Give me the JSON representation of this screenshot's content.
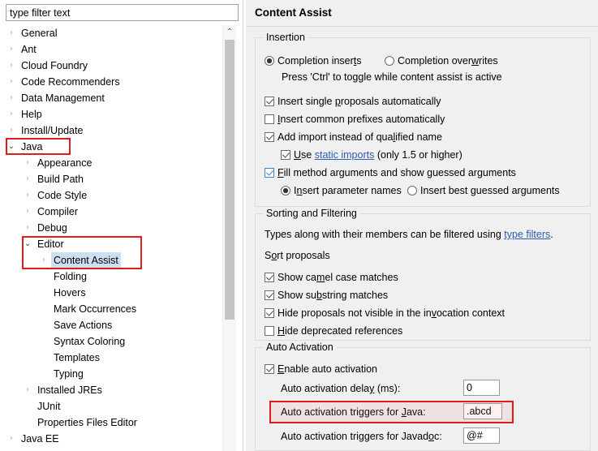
{
  "filter": {
    "placeholder": "type filter text",
    "value": ""
  },
  "tree": {
    "items": [
      {
        "label": "General",
        "indent": 0,
        "arrow": "collapsed",
        "selected": false
      },
      {
        "label": "Ant",
        "indent": 0,
        "arrow": "collapsed",
        "selected": false
      },
      {
        "label": "Cloud Foundry",
        "indent": 0,
        "arrow": "collapsed",
        "selected": false
      },
      {
        "label": "Code Recommenders",
        "indent": 0,
        "arrow": "collapsed",
        "selected": false
      },
      {
        "label": "Data Management",
        "indent": 0,
        "arrow": "collapsed",
        "selected": false
      },
      {
        "label": "Help",
        "indent": 0,
        "arrow": "collapsed",
        "selected": false
      },
      {
        "label": "Install/Update",
        "indent": 0,
        "arrow": "collapsed",
        "selected": false
      },
      {
        "label": "Java",
        "indent": 0,
        "arrow": "expanded",
        "selected": false
      },
      {
        "label": "Appearance",
        "indent": 1,
        "arrow": "collapsed",
        "selected": false
      },
      {
        "label": "Build Path",
        "indent": 1,
        "arrow": "collapsed",
        "selected": false
      },
      {
        "label": "Code Style",
        "indent": 1,
        "arrow": "collapsed",
        "selected": false
      },
      {
        "label": "Compiler",
        "indent": 1,
        "arrow": "collapsed",
        "selected": false
      },
      {
        "label": "Debug",
        "indent": 1,
        "arrow": "collapsed",
        "selected": false
      },
      {
        "label": "Editor",
        "indent": 1,
        "arrow": "expanded",
        "selected": false
      },
      {
        "label": "Content Assist",
        "indent": 2,
        "arrow": "collapsed",
        "selected": true
      },
      {
        "label": "Folding",
        "indent": 2,
        "arrow": "none",
        "selected": false
      },
      {
        "label": "Hovers",
        "indent": 2,
        "arrow": "none",
        "selected": false
      },
      {
        "label": "Mark Occurrences",
        "indent": 2,
        "arrow": "none",
        "selected": false
      },
      {
        "label": "Save Actions",
        "indent": 2,
        "arrow": "none",
        "selected": false
      },
      {
        "label": "Syntax Coloring",
        "indent": 2,
        "arrow": "none",
        "selected": false
      },
      {
        "label": "Templates",
        "indent": 2,
        "arrow": "none",
        "selected": false
      },
      {
        "label": "Typing",
        "indent": 2,
        "arrow": "none",
        "selected": false
      },
      {
        "label": "Installed JREs",
        "indent": 1,
        "arrow": "collapsed",
        "selected": false
      },
      {
        "label": "JUnit",
        "indent": 1,
        "arrow": "none",
        "selected": false
      },
      {
        "label": "Properties Files Editor",
        "indent": 1,
        "arrow": "none",
        "selected": false
      },
      {
        "label": "Java EE",
        "indent": 0,
        "arrow": "collapsed",
        "selected": false
      }
    ],
    "arrow_glyph_collapsed": "›",
    "arrow_glyph_expanded": "⌄",
    "selection_color": "#cde0f2"
  },
  "scrollbar": {
    "up_arrow_glyph": "⌃"
  },
  "page": {
    "title": "Content Assist"
  },
  "insertion": {
    "group_title": "Insertion",
    "radio_inserts": {
      "label_a": "Completion inser",
      "mnemonic": "t",
      "label_b": "s",
      "checked": true
    },
    "radio_overwrites": {
      "label_a": "Completion over",
      "mnemonic": "w",
      "label_b": "rites",
      "checked": false
    },
    "hint": "Press 'Ctrl' to toggle while content assist is active",
    "cb_single_proposals": {
      "label_a": "Insert single ",
      "mnemonic": "p",
      "label_b": "roposals automatically",
      "checked": true,
      "focused": false
    },
    "cb_common_prefixes": {
      "label_a": "",
      "mnemonic": "I",
      "label_b": "nsert common prefixes automatically",
      "checked": false,
      "focused": false
    },
    "cb_add_import": {
      "label_a": "Add import instead of qua",
      "mnemonic": "l",
      "label_b": "ified name",
      "checked": true,
      "focused": false
    },
    "cb_static_imports": {
      "label_a": "",
      "mnemonic": "U",
      "label_b": "se ",
      "link": "static imports",
      "label_c": " (only 1.5 or higher)",
      "checked": true,
      "focused": false
    },
    "cb_fill_method_args": {
      "label_a": "",
      "mnemonic": "F",
      "label_b": "ill method arguments and show guessed arguments",
      "checked": true,
      "focused": true
    },
    "radio_param_names": {
      "label_a": "I",
      "mnemonic": "n",
      "label_b": "sert parameter names",
      "checked": true
    },
    "radio_best_guessed": {
      "label_a": "Insert best ",
      "mnemonic": "g",
      "label_b": "uessed arguments",
      "checked": false
    }
  },
  "sorting": {
    "group_title": "Sorting and Filtering",
    "description_a": "Types along with their members can be filtered using ",
    "description_link": "type filters",
    "description_b": ".",
    "sort_label_a": "S",
    "sort_label_mnemonic": "o",
    "sort_label_b": "rt proposals",
    "cb_camel_case": {
      "label_a": "Show ca",
      "mnemonic": "m",
      "label_b": "el case matches",
      "checked": true
    },
    "cb_substring": {
      "label_a": "Show su",
      "mnemonic": "b",
      "label_b": "string matches",
      "checked": true
    },
    "cb_hide_not_visible": {
      "label_a": "Hide proposals not visible in the in",
      "mnemonic": "v",
      "label_b": "ocation context",
      "checked": true
    },
    "cb_hide_deprecated": {
      "label_a": "",
      "mnemonic": "H",
      "label_b": "ide deprecated references",
      "checked": false
    }
  },
  "auto_activation": {
    "group_title": "Auto Activation",
    "cb_enable": {
      "label_a": "",
      "mnemonic": "E",
      "label_b": "nable auto activation",
      "checked": true
    },
    "delay_label_a": "Auto activation dela",
    "delay_label_mnemonic": "y",
    "delay_label_b": " (ms):",
    "delay_value": "0",
    "java_label_a": "Auto activation triggers for ",
    "java_label_mnemonic": "J",
    "java_label_b": "ava:",
    "java_value": ".abcd",
    "javadoc_label_a": "Auto activation triggers for Javad",
    "javadoc_label_mnemonic": "o",
    "javadoc_label_b": "c:",
    "javadoc_value": "@#"
  },
  "annotations": {
    "color": "#e01b1b",
    "boxes": [
      {
        "name": "annot-java-node"
      },
      {
        "name": "annot-editor-content-assist"
      },
      {
        "name": "annot-java-triggers-row"
      }
    ]
  }
}
